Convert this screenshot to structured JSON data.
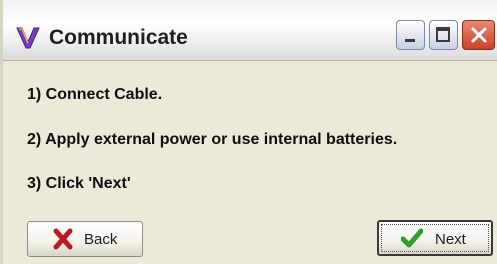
{
  "window": {
    "title": "Communicate"
  },
  "steps": [
    "1) Connect Cable.",
    "2) Apply external power or use internal batteries.",
    "3) Click 'Next'"
  ],
  "buttons": {
    "back_label": "Back",
    "next_label": "Next"
  },
  "icons": {
    "app": "v-logo-icon",
    "back": "red-x-icon",
    "next": "green-checkmark-icon",
    "minimize": "minimize-icon",
    "maximize": "maximize-icon",
    "close": "close-icon"
  },
  "colors": {
    "close_button": "#c8422a",
    "back_icon": "#c0191d",
    "next_icon": "#2e9d2c",
    "app_icon": "#7a3ec4"
  }
}
